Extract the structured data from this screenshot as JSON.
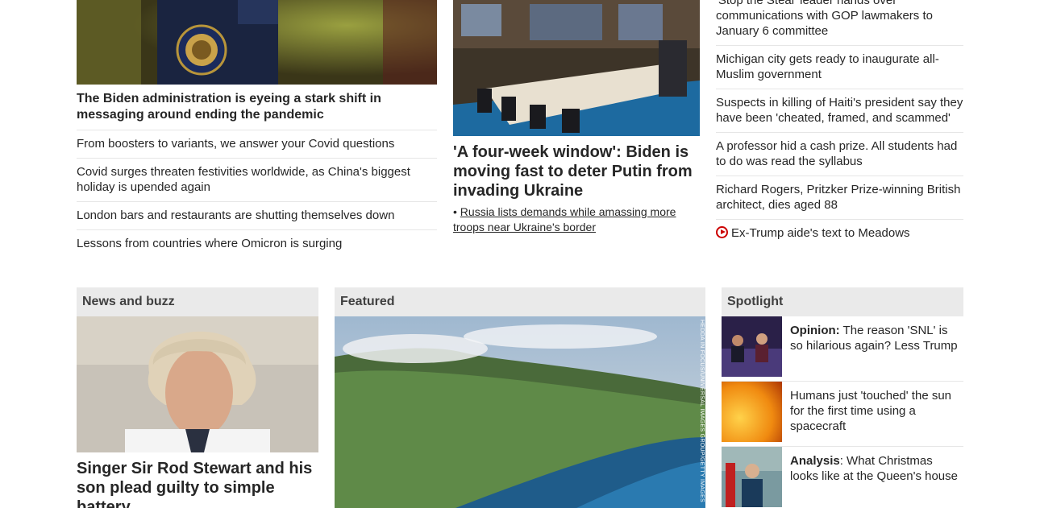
{
  "top_left": {
    "lead_headline": "The Biden administration is eyeing a stark shift in messaging around ending the pandemic",
    "items": [
      "From boosters to variants, we answer your Covid questions",
      "Covid surges threaten festivities worldwide, as China's biggest holiday is upended again",
      "London bars and restaurants are shutting themselves down",
      "Lessons from countries where Omicron is surging"
    ]
  },
  "top_mid": {
    "headline": "'A four-week window': Biden is moving fast to deter Putin from invading Ukraine",
    "sub_bullet": "•",
    "sub_link": "Russia lists demands while amassing more troops near Ukraine's border"
  },
  "top_right": {
    "items": [
      "'Stop the Steal' leader hands over communications with GOP lawmakers to January 6 committee",
      "Michigan city gets ready to inaugurate all-Muslim government",
      "Suspects in killing of Haiti's president say they have been 'cheated, framed, and scammed'",
      "A professor hid a cash prize. All students had to do was read the syllabus",
      "Richard Rogers, Pritzker Prize-winning British architect, dies aged 88"
    ],
    "video_item": "Ex-Trump aide's text to Meadows"
  },
  "news_buzz": {
    "header": "News and buzz",
    "headline": "Singer Sir Rod Stewart and his son plead guilty to simple battery"
  },
  "featured": {
    "header": "Featured",
    "photo_credit": "HEDDA IN FOCUS/UNIVERSAL IMAGES GROUP/GETTY IMAGES"
  },
  "spotlight": {
    "header": "Spotlight",
    "items": [
      {
        "label": "Opinion:",
        "text": " The reason 'SNL' is so hilarious again? Less Trump"
      },
      {
        "label": "",
        "text": "Humans just 'touched' the sun for the first time using a spacecraft"
      },
      {
        "label": "Analysis",
        "text": ": What Christmas looks like at the Queen's house"
      }
    ]
  },
  "colors": {
    "accent_red": "#cc0000",
    "section_header_bg": "#eaeaea",
    "divider": "#e6e6e6"
  }
}
